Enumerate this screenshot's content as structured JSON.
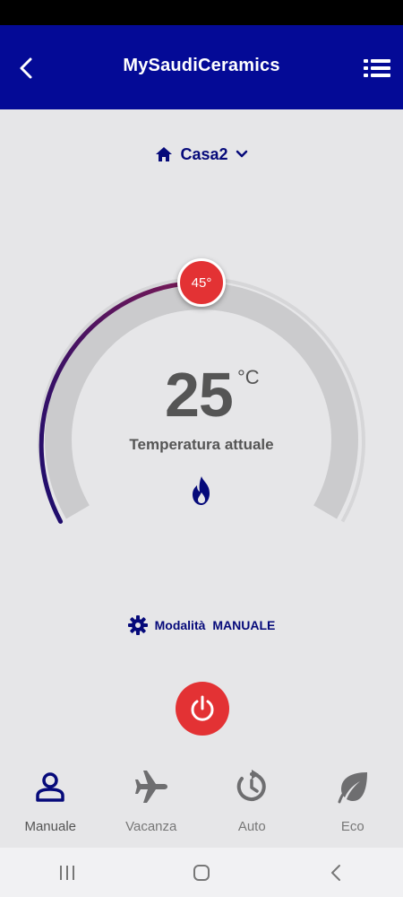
{
  "header": {
    "title": "MySaudiCeramics",
    "background": "#040a96"
  },
  "home": {
    "name": "Casa2"
  },
  "thermostat": {
    "current_temperature": "25",
    "unit": "°C",
    "current_label": "Temperatura attuale",
    "setpoint": "45°",
    "heating_icon": "flame-icon",
    "accent_color": "#e33234"
  },
  "mode": {
    "prefix": "Modalità",
    "value": "MANUALE"
  },
  "tabs": [
    {
      "label": "Manuale",
      "icon": "person-icon",
      "active": true
    },
    {
      "label": "Vacanza",
      "icon": "airplane-icon",
      "active": false
    },
    {
      "label": "Auto",
      "icon": "clock-refresh-icon",
      "active": false
    },
    {
      "label": "Eco",
      "icon": "leaf-icon",
      "active": false
    }
  ]
}
